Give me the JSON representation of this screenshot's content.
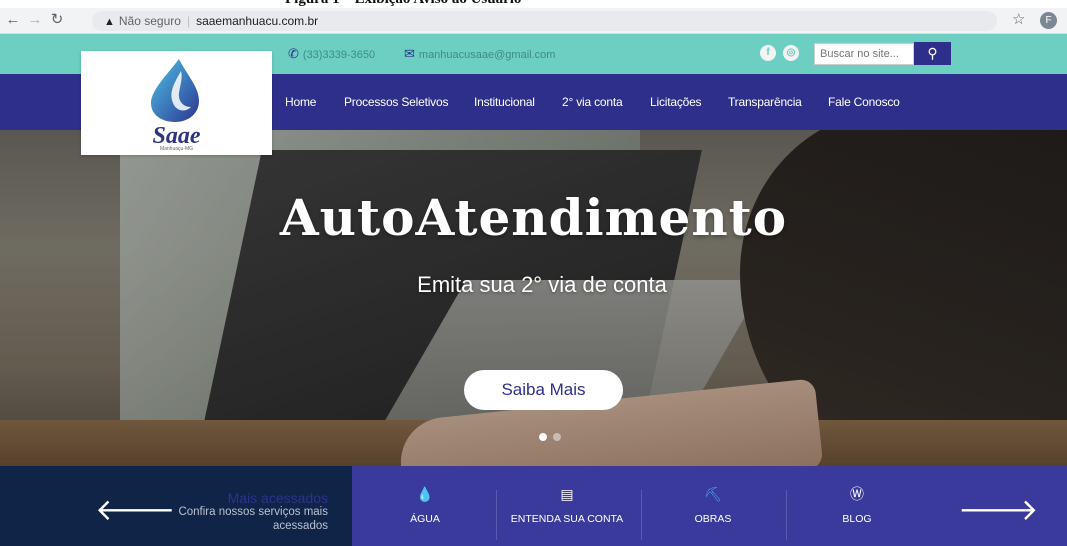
{
  "browser": {
    "security_label": "Não seguro",
    "url": "saaemanhuacu.com.br",
    "profile_initial": "F"
  },
  "doc_caption": "Figura 1 – Exibição Aviso ao Usuário",
  "topbar": {
    "phone": "(33)3339-3650",
    "email": "manhuacusaae@gmail.com",
    "search_placeholder": "Buscar no site...",
    "color": "#6ccfc1"
  },
  "logo": {
    "name": "Saae",
    "tagline": "Manhuaçu-MG"
  },
  "nav": {
    "color": "#2e2f8a",
    "items": [
      {
        "label": "Home"
      },
      {
        "label": "Processos Seletivos"
      },
      {
        "label": "Institucional"
      },
      {
        "label": "2° via conta"
      },
      {
        "label": "Licitações"
      },
      {
        "label": "Transparência"
      },
      {
        "label": "Fale Conosco"
      }
    ]
  },
  "hero": {
    "title": "AutoAtendimento",
    "subtitle": "Emita sua 2° via de conta",
    "button_label": "Saiba Mais",
    "active_slide": 1,
    "slide_count": 2
  },
  "bottom": {
    "mais_title": "Mais acessados",
    "mais_desc": "Confira nossos serviços mais acessados",
    "services": [
      {
        "label": "ÁGUA",
        "icon": "water-drop-icon"
      },
      {
        "label": "ENTENDA SUA CONTA",
        "icon": "document-icon"
      },
      {
        "label": "OBRAS",
        "icon": "construction-icon"
      },
      {
        "label": "BLOG",
        "icon": "wordpress-icon"
      }
    ],
    "left_color": "#0f2447",
    "right_color": "#3a3a9c"
  }
}
